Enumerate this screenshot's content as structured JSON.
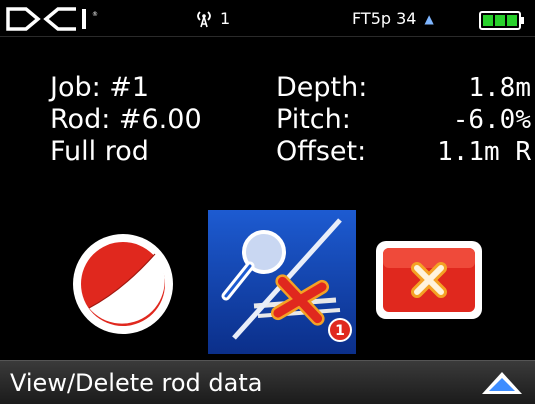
{
  "status": {
    "logo_text": "DCI",
    "signal_icon": "antenna-icon",
    "channel": "1",
    "frequency": "FT5p 34",
    "up_icon": "triangle-up-icon",
    "battery_icon": "battery-icon"
  },
  "info": {
    "job": "Job: #1",
    "rod": "Rod: #6.00",
    "rod_state": "Full rod",
    "depth_label": "Depth:",
    "depth_value": "1.8m",
    "pitch_label": "Pitch:",
    "pitch_value": "-6.0%",
    "offset_label": "Offset:",
    "offset_value": "1.1m R"
  },
  "buttons": {
    "circle_icon": "half-circle-gauge-icon",
    "view_delete_icon": "magnifier-delete-icon",
    "badge": "1",
    "cancel_icon": "cancel-x-icon"
  },
  "bottom": {
    "label": "View/Delete rod data",
    "nav_icon": "triangle-up-icon"
  },
  "colors": {
    "accent_blue": "#1d5bd1",
    "red": "#e0281e",
    "orange": "#f4a224",
    "battery_green": "#29d12c"
  }
}
